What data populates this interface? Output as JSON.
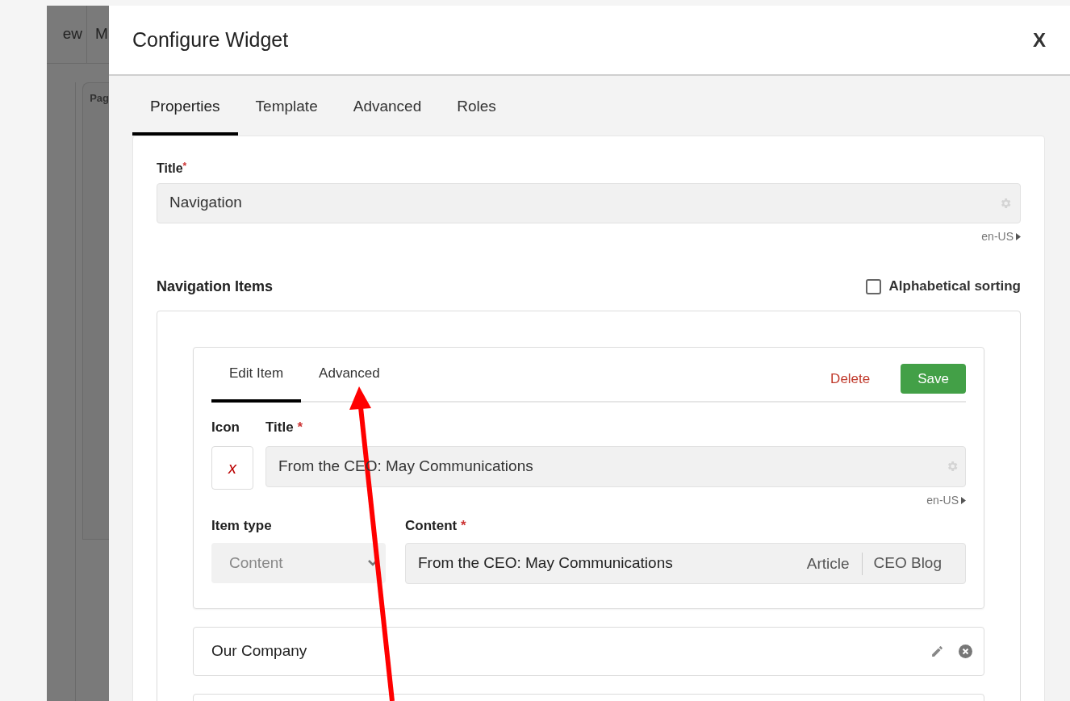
{
  "background_app": {
    "menu": [
      "ew",
      "M"
    ],
    "panel_title": "Pag"
  },
  "dialog": {
    "title": "Configure Widget",
    "close": "X",
    "tabs": [
      {
        "label": "Properties",
        "selected": true
      },
      {
        "label": "Template",
        "selected": false
      },
      {
        "label": "Advanced",
        "selected": false
      },
      {
        "label": "Roles",
        "selected": false
      }
    ],
    "title_field": {
      "label": "Title",
      "required_mark": "*",
      "value": "Navigation",
      "locale": "en-US"
    },
    "navigation_items": {
      "heading": "Navigation Items",
      "alphabetical_sorting": {
        "label": "Alphabetical sorting",
        "checked": false
      },
      "editor": {
        "tabs": [
          {
            "label": "Edit Item",
            "selected": true
          },
          {
            "label": "Advanced",
            "selected": false
          }
        ],
        "delete": "Delete",
        "save": "Save",
        "icon_label": "Icon",
        "icon_value": "x",
        "title_label": "Title",
        "title_required_mark": "*",
        "title_value": "From the CEO: May Communications",
        "locale": "en-US",
        "item_type_label": "Item type",
        "item_type_value": "Content",
        "content_label": "Content",
        "content_required_mark": "*",
        "content_value": "From the CEO: May Communications",
        "content_type": "Article",
        "content_source": "CEO Blog"
      },
      "items": [
        {
          "label": "Our Company"
        }
      ],
      "next_item_partly_shown": true
    }
  }
}
